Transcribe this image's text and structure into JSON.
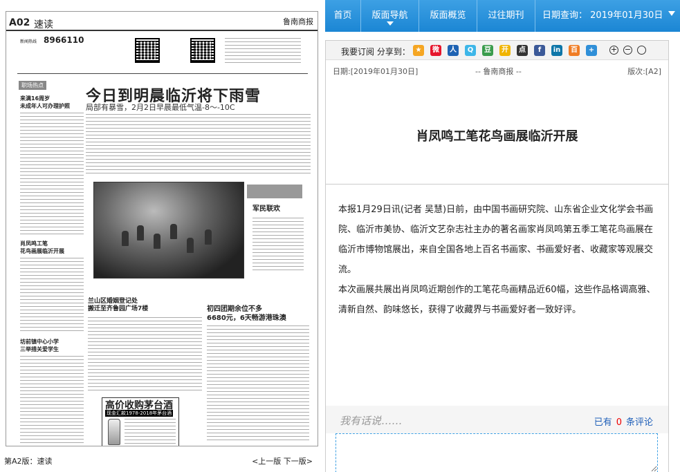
{
  "newspaper": {
    "page_number": "A02",
    "section": "速读",
    "brand": "鲁南商报",
    "hotline_label": "新闻热线",
    "hotline_number": "8966110",
    "headline": "今日到明晨临沂将下雨雪",
    "subheadline": "局部有暴雪，2月2日早晨最低气温-8～-10C",
    "stories": {
      "s1_tag": "职场热点",
      "s1_title": "来满16周岁\n未成年人可办理护照",
      "s2_title": "肖凤鸣工笔\n花鸟画展临沂开展",
      "s3_title": "坊前镇中心小学\n三举措关爱学生",
      "s4_title": "军民联欢",
      "s5_title": "兰山区婚姻登记处\n搬迁至齐鲁园广场7楼",
      "s6_title": "初四团期余位不多\n6680元，6天畅游港珠澳",
      "ad_title": "高价收购茅台酒",
      "ad_sub": "现金汇款1978-2018年茅台酒"
    },
    "footer_label": "第A2版：速读",
    "nav_prev": "<上一版",
    "nav_next": "下一版>"
  },
  "topnav": {
    "items": [
      "首页",
      "版面导航",
      "版面概览",
      "过往期刊"
    ],
    "active_index": 1,
    "date_label": "日期查询：",
    "date_value": "2019年01月30日"
  },
  "share": {
    "label": "我要订阅 分享到：",
    "icons": [
      {
        "name": "qzone-icon",
        "color": "#f5a623",
        "glyph": "★"
      },
      {
        "name": "weibo-icon",
        "color": "#e6162d",
        "glyph": "微"
      },
      {
        "name": "renren-icon",
        "color": "#1f63b3",
        "glyph": "人"
      },
      {
        "name": "tencent-weibo-icon",
        "color": "#3db6e8",
        "glyph": "Q"
      },
      {
        "name": "douban-icon",
        "color": "#3a9c4d",
        "glyph": "豆"
      },
      {
        "name": "kaixin-icon",
        "color": "#f0b400",
        "glyph": "开"
      },
      {
        "name": "diandian-icon",
        "color": "#333333",
        "glyph": "点"
      },
      {
        "name": "facebook-icon",
        "color": "#3b5998",
        "glyph": "f"
      },
      {
        "name": "linkedin-icon",
        "color": "#0e76a8",
        "glyph": "in"
      },
      {
        "name": "baidu-icon",
        "color": "#f07c24",
        "glyph": "百"
      },
      {
        "name": "more-share-icon",
        "color": "#2f8fd8",
        "glyph": "+"
      }
    ],
    "zoom": [
      "+",
      "−",
      ""
    ]
  },
  "article": {
    "date": "日期:[2019年01月30日]",
    "publication": "-- 鲁南商报 --",
    "page": "版次:[A2]",
    "title": "肖凤鸣工笔花鸟画展临沂开展",
    "paragraphs": [
      "本报1月29日讯(记者 吴慧)日前，由中国书画研究院、山东省企业文化学会书画院、临沂市美协、临沂文艺杂志社主办的著名画家肖凤鸣第五季工笔花鸟画展在临沂市博物馆展出，来自全国各地上百名书画家、书画爱好者、收藏家等观展交流。",
      "本次画展共展出肖凤鸣近期创作的工笔花鸟画精品近60幅，这些作品格调高雅、清新自然、韵味悠长，获得了收藏界与书画爱好者一致好评。"
    ]
  },
  "comments": {
    "label": "我有话说……",
    "count_prefix": "已有",
    "count": "0",
    "count_suffix": "条评论"
  }
}
